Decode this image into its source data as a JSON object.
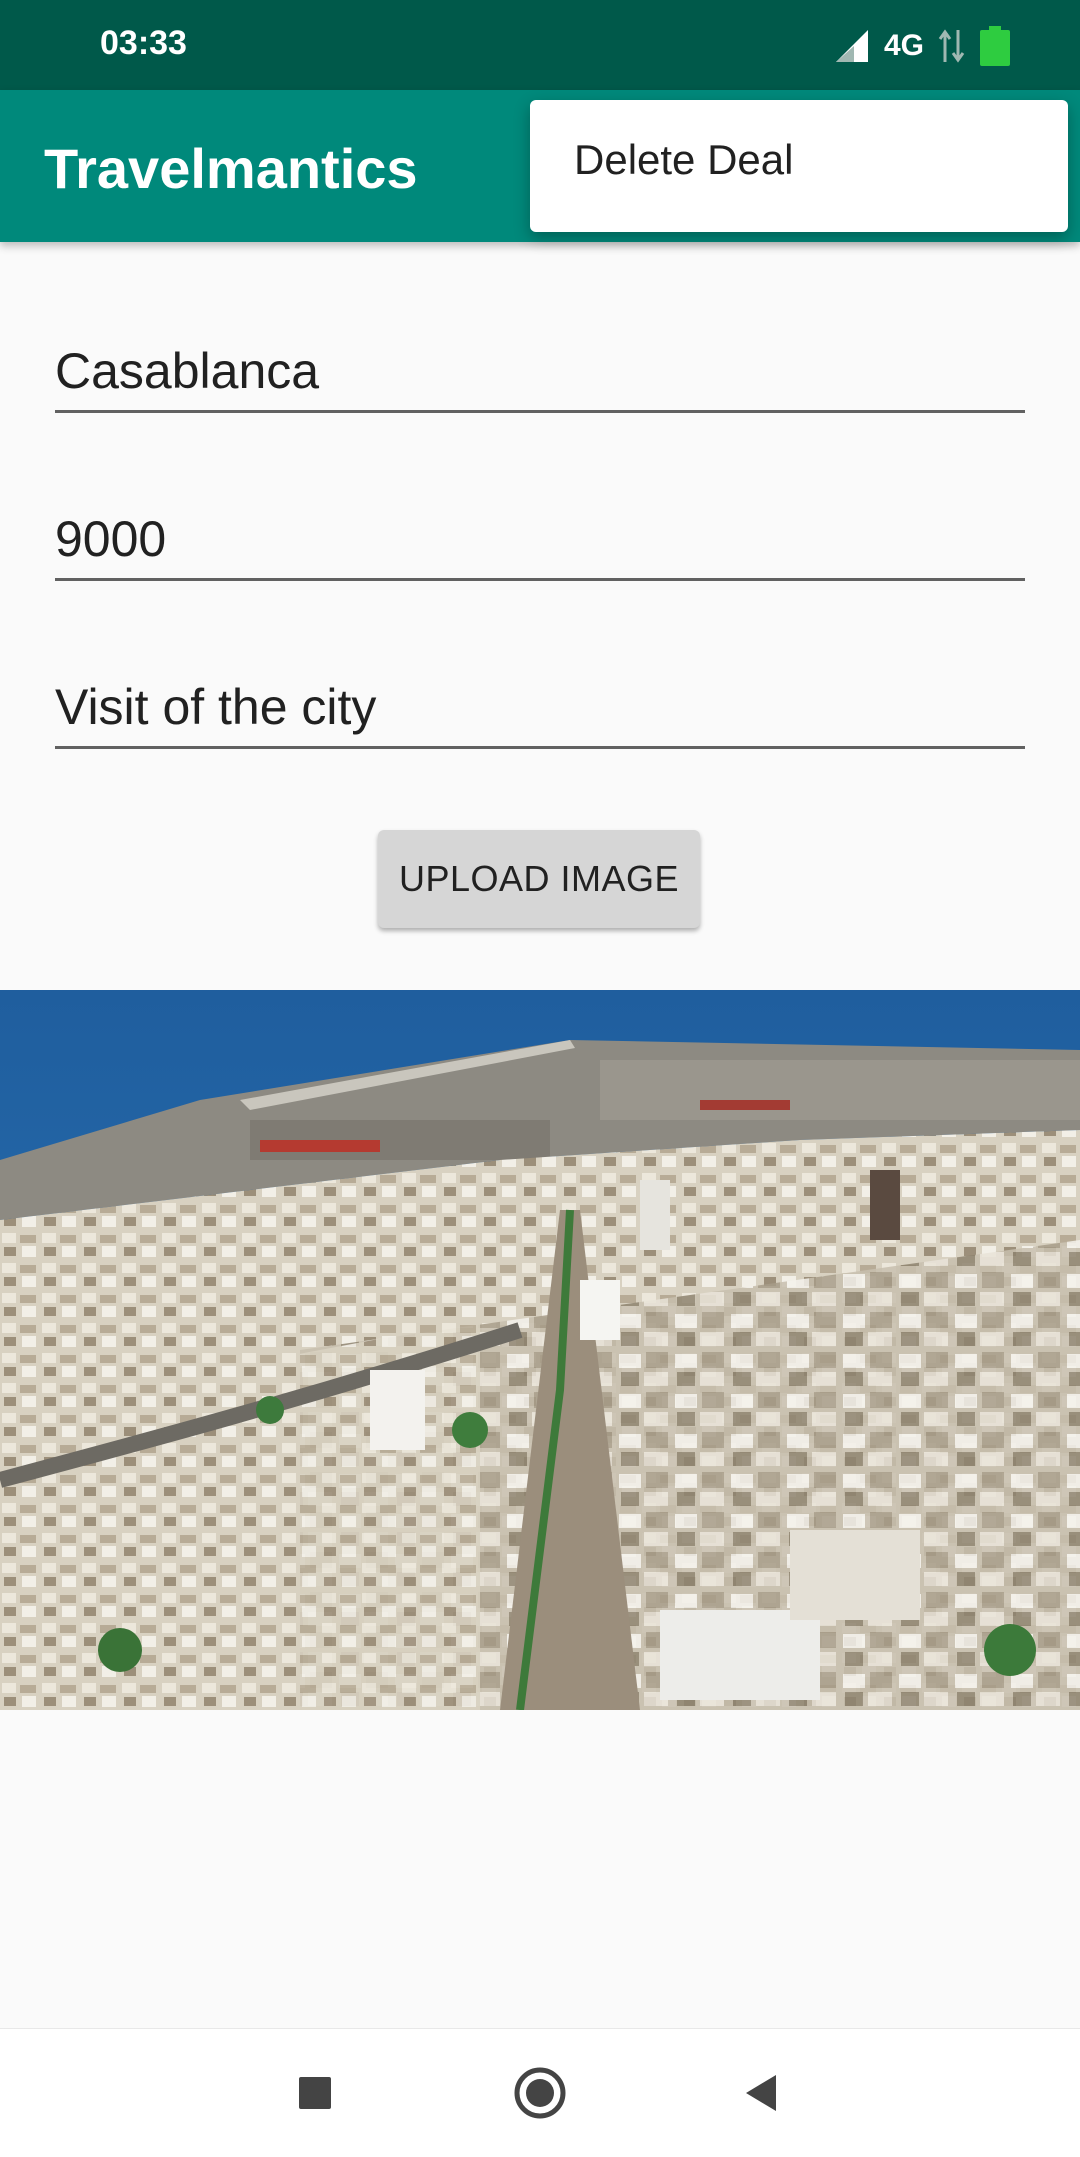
{
  "status_bar": {
    "time": "03:33",
    "network": "4G",
    "icons": [
      "signal-icon",
      "network-activity-icon",
      "battery-icon"
    ]
  },
  "app_bar": {
    "title": "Travelmantics",
    "background": "#00897b"
  },
  "overflow_menu": {
    "items": [
      {
        "label": "Delete Deal"
      }
    ]
  },
  "form": {
    "title_value": "Casablanca",
    "price_value": "9000",
    "description_value": "Visit of the city",
    "upload_button_label": "UPLOAD IMAGE"
  },
  "image": {
    "description_icon": "city-photo"
  },
  "nav_bar": {
    "buttons": [
      "recents-square-icon",
      "home-circle-icon",
      "back-triangle-icon"
    ]
  }
}
